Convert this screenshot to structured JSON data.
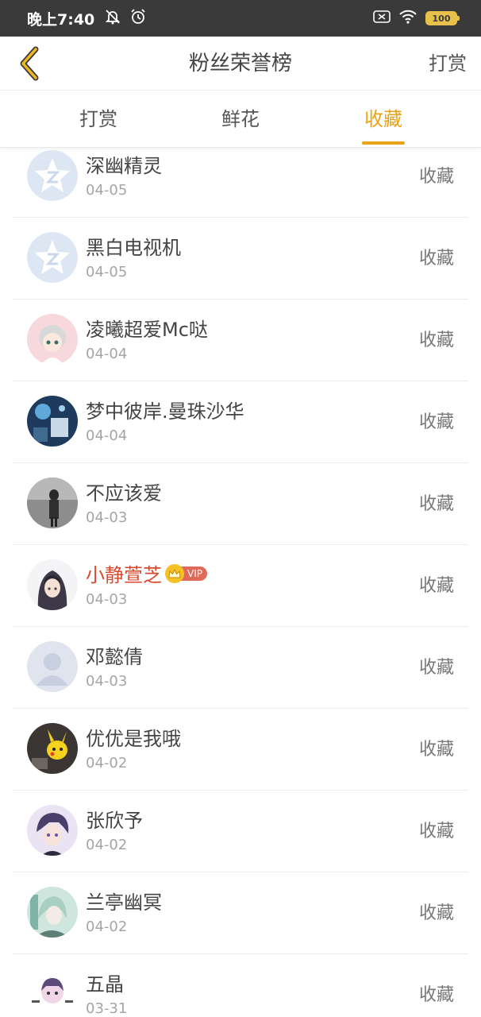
{
  "status": {
    "time": "晚上7:40",
    "battery": "100"
  },
  "header": {
    "title": "粉丝荣誉榜",
    "action": "打赏"
  },
  "tabs": [
    {
      "label": "打赏",
      "active": false
    },
    {
      "label": "鲜花",
      "active": false
    },
    {
      "label": "收藏",
      "active": true
    }
  ],
  "colors": {
    "accent": "#e8a317",
    "vip_name": "#d9492e"
  },
  "fans": [
    {
      "name": "深幽精灵",
      "date": "04-05",
      "action": "收藏",
      "avatar": "default-qq-avatar"
    },
    {
      "name": "黑白电视机",
      "date": "04-05",
      "action": "收藏",
      "avatar": "default-qq-avatar"
    },
    {
      "name": "凌曦超爱Mc哒",
      "date": "04-04",
      "action": "收藏",
      "avatar": "anime-girl-avatar"
    },
    {
      "name": "梦中彼岸.曼珠沙华",
      "date": "04-04",
      "action": "收藏",
      "avatar": "night-scene-avatar"
    },
    {
      "name": "不应该爱",
      "date": "04-03",
      "action": "收藏",
      "avatar": "street-photo-avatar"
    },
    {
      "name": "小静萱芝",
      "date": "04-03",
      "action": "收藏",
      "avatar": "hooded-boy-avatar",
      "vip": true,
      "vip_label": "VIP"
    },
    {
      "name": "邓懿倩",
      "date": "04-03",
      "action": "收藏",
      "avatar": "default-person-avatar"
    },
    {
      "name": "优优是我哦",
      "date": "04-02",
      "action": "收藏",
      "avatar": "pikachu-avatar"
    },
    {
      "name": "张欣予",
      "date": "04-02",
      "action": "收藏",
      "avatar": "anime-boy-avatar"
    },
    {
      "name": "兰亭幽冥",
      "date": "04-02",
      "action": "收藏",
      "avatar": "green-anime-avatar"
    },
    {
      "name": "五晶",
      "date": "03-31",
      "action": "收藏",
      "avatar": "chibi-avatar"
    }
  ]
}
